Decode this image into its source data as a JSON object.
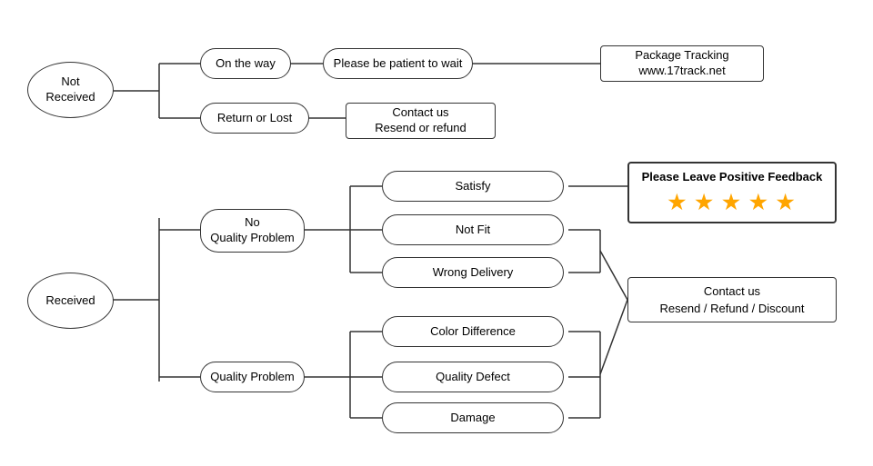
{
  "nodes": {
    "not_received": {
      "label": "Not\nReceived"
    },
    "received": {
      "label": "Received"
    },
    "on_the_way": {
      "label": "On the way"
    },
    "return_or_lost": {
      "label": "Return or Lost"
    },
    "patient": {
      "label": "Please be patient to wait"
    },
    "contact_resend_refund": {
      "label": "Contact us\nResend or refund"
    },
    "package_tracking": {
      "label": "Package Tracking\nwww.17track.net"
    },
    "no_quality_problem": {
      "label": "No\nQuality Problem"
    },
    "quality_problem": {
      "label": "Quality Problem"
    },
    "satisfy": {
      "label": "Satisfy"
    },
    "not_fit": {
      "label": "Not Fit"
    },
    "wrong_delivery": {
      "label": "Wrong Delivery"
    },
    "color_difference": {
      "label": "Color Difference"
    },
    "quality_defect": {
      "label": "Quality Defect"
    },
    "damage": {
      "label": "Damage"
    },
    "feedback": {
      "label": "Please Leave Positive Feedback"
    },
    "stars": {
      "value": "★ ★ ★ ★ ★"
    },
    "contact_resend_refund_discount": {
      "label": "Contact us\nResend / Refund / Discount"
    }
  }
}
